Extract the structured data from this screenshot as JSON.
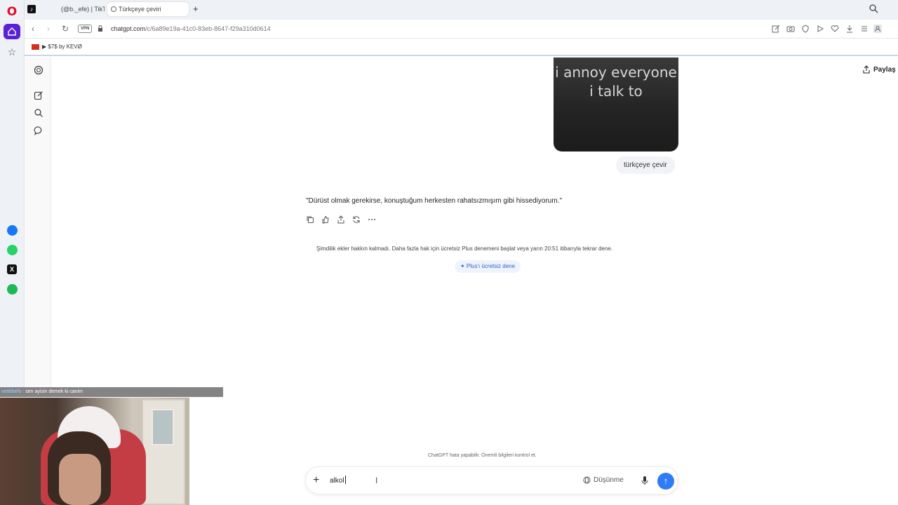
{
  "browser": {
    "tabs": [
      {
        "label": "(@b._efe) | TikTok",
        "active": false
      },
      {
        "label": "Türkçeye çeviri",
        "active": true
      }
    ],
    "address": {
      "vpn": "VPN",
      "url_host": "chatgpt.com",
      "url_path": "/c/6a89e19a-41c0-83eb-8647-f29a310d0614"
    },
    "bookmark_label": "▶ $7$ by KEVØ"
  },
  "header": {
    "share_label": "Paylaş"
  },
  "conversation": {
    "image_caption": "i annoy everyone i talk to",
    "user_message": "türkçeye çevir",
    "assistant_message": "\"Dürüst olmak gerekirse, konuştuğum herkesten rahatsızmışım gibi hissediyorum.\"",
    "limit_note": "Şimdilik ekler hakkın kalmadı. Daha fazla hak için ücretsiz Plus denemeni başlat veya yarın 20:51 itibarıyla tekrar dene.",
    "plus_button": "✦ Plus'ı ücretsiz dene"
  },
  "composer": {
    "value": "alkol",
    "think_label": "Düşünme",
    "disclaimer": "ChatGPT hata yapabilir. Önemli bilgileri kontrol et."
  },
  "overlay": {
    "chat_user": "vetlebefo :",
    "chat_text": "sen ayisin demek ki canim"
  },
  "colors": {
    "opera_red": "#e0112b",
    "home_purple": "#5b21d6",
    "send_blue": "#2f7cf6",
    "messenger_blue": "#1877f2",
    "whatsapp_green": "#25d366",
    "spotify_green": "#1db954"
  }
}
